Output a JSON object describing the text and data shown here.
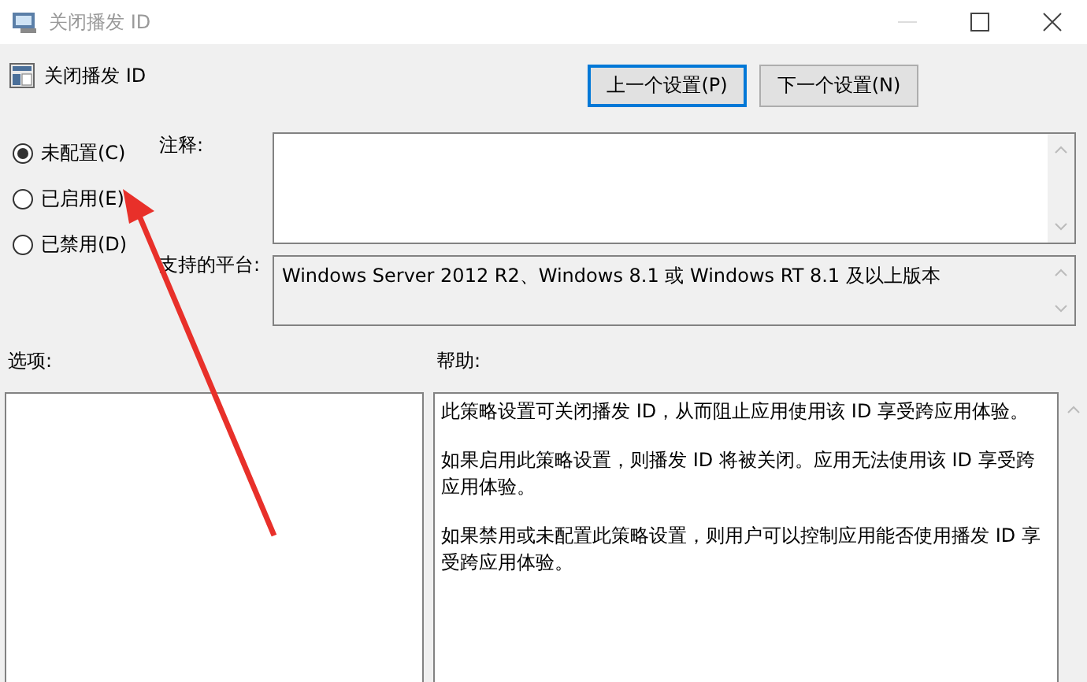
{
  "window": {
    "title": "关闭播发 ID"
  },
  "policy": {
    "title": "关闭播发 ID"
  },
  "buttons": [
    {
      "label": "上一个设置(P)",
      "focused": true
    },
    {
      "label": "下一个设置(N)",
      "focused": false
    }
  ],
  "states": [
    {
      "label": "未配置(C)",
      "selected": true
    },
    {
      "label": "已启用(E)",
      "selected": false
    },
    {
      "label": "已禁用(D)",
      "selected": false
    }
  ],
  "comment": {
    "label": "注释:"
  },
  "platform": {
    "label": "支持的平台:",
    "value": "Windows Server 2012 R2、Windows 8.1 或 Windows RT 8.1 及以上版本"
  },
  "options": {
    "label": "选项:"
  },
  "help": {
    "label": "帮助:",
    "paragraphs": [
      "此策略设置可关闭播发 ID，从而阻止应用使用该 ID 享受跨应用体验。",
      "如果启用此策略设置，则播发 ID 将被关闭。应用无法使用该 ID 享受跨应用体验。",
      "如果禁用或未配置此策略设置，则用户可以控制应用能否使用播发 ID 享受跨应用体验。"
    ]
  }
}
